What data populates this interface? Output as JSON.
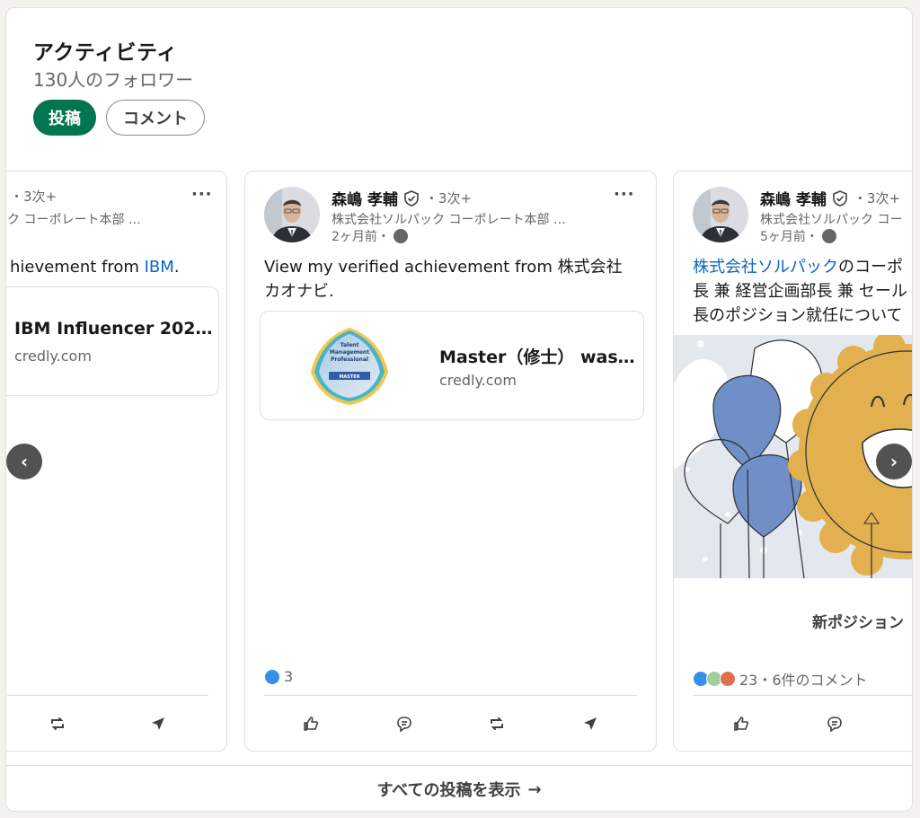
{
  "header": {
    "title": "アクティビティ",
    "followers": "130人のフォロワー",
    "tabs": [
      {
        "label": "投稿",
        "active": true
      },
      {
        "label": "コメント",
        "active": false
      }
    ]
  },
  "cards": [
    {
      "degree": "・3次+",
      "subtitle": "ク コーポレート本部 …",
      "text_plain": "hievement from ",
      "text_link": "IBM",
      "text_after": ".",
      "link_title": "IBM Influencer 202…",
      "link_domain": "credly.com"
    },
    {
      "author": "森嶋 孝輔",
      "degree": "・3次+",
      "subtitle": "株式会社ソルパック コーポレート本部 …",
      "time": "2ヶ月前・",
      "text": "View my verified achievement from 株式会社カオナビ.",
      "badge_lines": [
        "Talent",
        "Management",
        "Professional",
        "MASTER"
      ],
      "link_title": "Master（修士） was…",
      "link_domain": "credly.com",
      "reaction_count": "3"
    },
    {
      "author": "森嶋 孝輔",
      "degree": "・3次+",
      "subtitle": "株式会社ソルパック コー",
      "time": "5ヶ月前・",
      "text_link": "株式会社ソルパック",
      "text_rest": "のコーポ",
      "text_line2": "長 兼 経営企画部長 兼 セール",
      "text_line3": "長のポジション就任について",
      "caption": "新ポジション",
      "reaction_summary": "23・6件のコメント"
    }
  ],
  "nav": {
    "prev": "‹",
    "next": "›"
  },
  "footer": {
    "label": "すべての投稿を表示",
    "arrow": "→"
  },
  "colors": {
    "accent_green": "#01754f",
    "link_blue": "#0a66c2",
    "balloon_blue": "#6f8fc6",
    "sun_gold": "#e2b04f"
  },
  "icons": [
    "shield-check-icon",
    "globe-icon",
    "like-icon",
    "comment-icon",
    "repost-icon",
    "send-icon",
    "more-icon",
    "chevron-left-icon",
    "chevron-right-icon",
    "arrow-right-icon"
  ]
}
